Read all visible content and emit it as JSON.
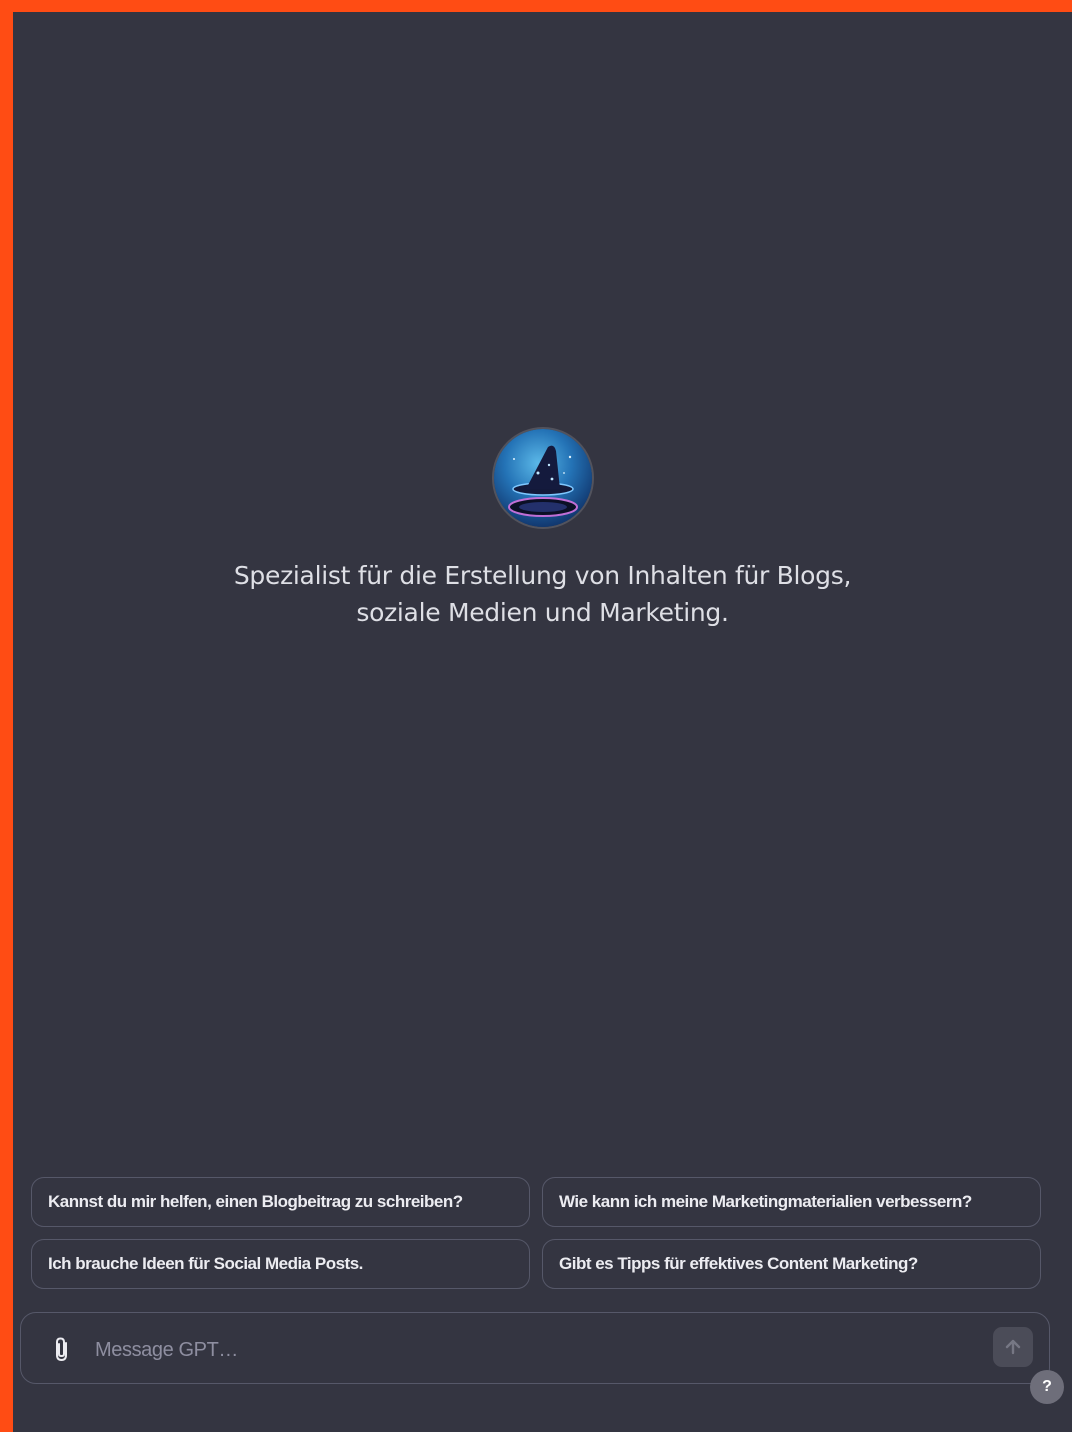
{
  "gpt": {
    "avatar_icon": "wizard-hat-icon",
    "description": "Spezialist für die Erstellung von Inhalten für Blogs, soziale Medien und Marketing."
  },
  "suggestions": [
    {
      "label": "Kannst du mir helfen, einen Blogbeitrag zu schreiben?"
    },
    {
      "label": "Wie kann ich meine Marketingmaterialien verbessern?"
    },
    {
      "label": "Ich brauche Ideen für Social Media Posts."
    },
    {
      "label": "Gibt es Tipps für effektives Content Marketing?"
    }
  ],
  "composer": {
    "placeholder": "Message GPT…",
    "value": "",
    "attach_icon": "paperclip-icon",
    "send_icon": "arrow-up-icon"
  },
  "help": {
    "label": "?"
  },
  "colors": {
    "background": "#343541",
    "frame_border": "#ff4c14",
    "border": "#565869",
    "text": "#ececf1"
  }
}
